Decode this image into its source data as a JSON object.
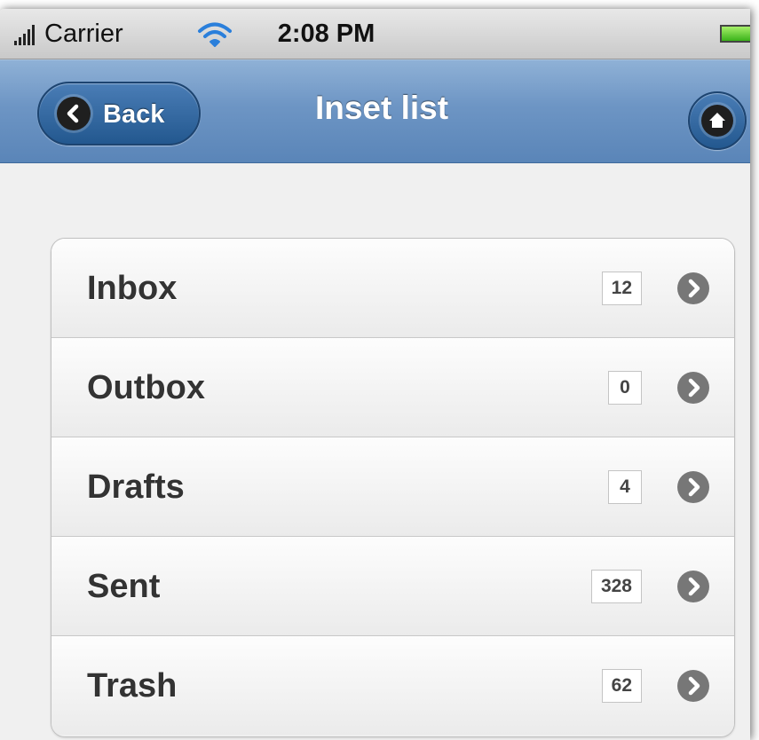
{
  "status_bar": {
    "carrier": "Carrier",
    "time": "2:08 PM"
  },
  "header": {
    "back_label": "Back",
    "title": "Inset list"
  },
  "list": {
    "items": [
      {
        "label": "Inbox",
        "count": "12"
      },
      {
        "label": "Outbox",
        "count": "0"
      },
      {
        "label": "Drafts",
        "count": "4"
      },
      {
        "label": "Sent",
        "count": "328"
      },
      {
        "label": "Trash",
        "count": "62"
      }
    ]
  },
  "colors": {
    "header_blue": "#6d95c4",
    "button_blue": "#23588f",
    "list_background": "#f0f0f0",
    "battery_green": "#3ab21a"
  },
  "icons": {
    "signal": "signal-bars-icon",
    "wifi": "wifi-icon",
    "battery": "battery-icon",
    "back": "chevron-left-icon",
    "home": "home-icon",
    "row_arrow": "chevron-right-icon"
  }
}
